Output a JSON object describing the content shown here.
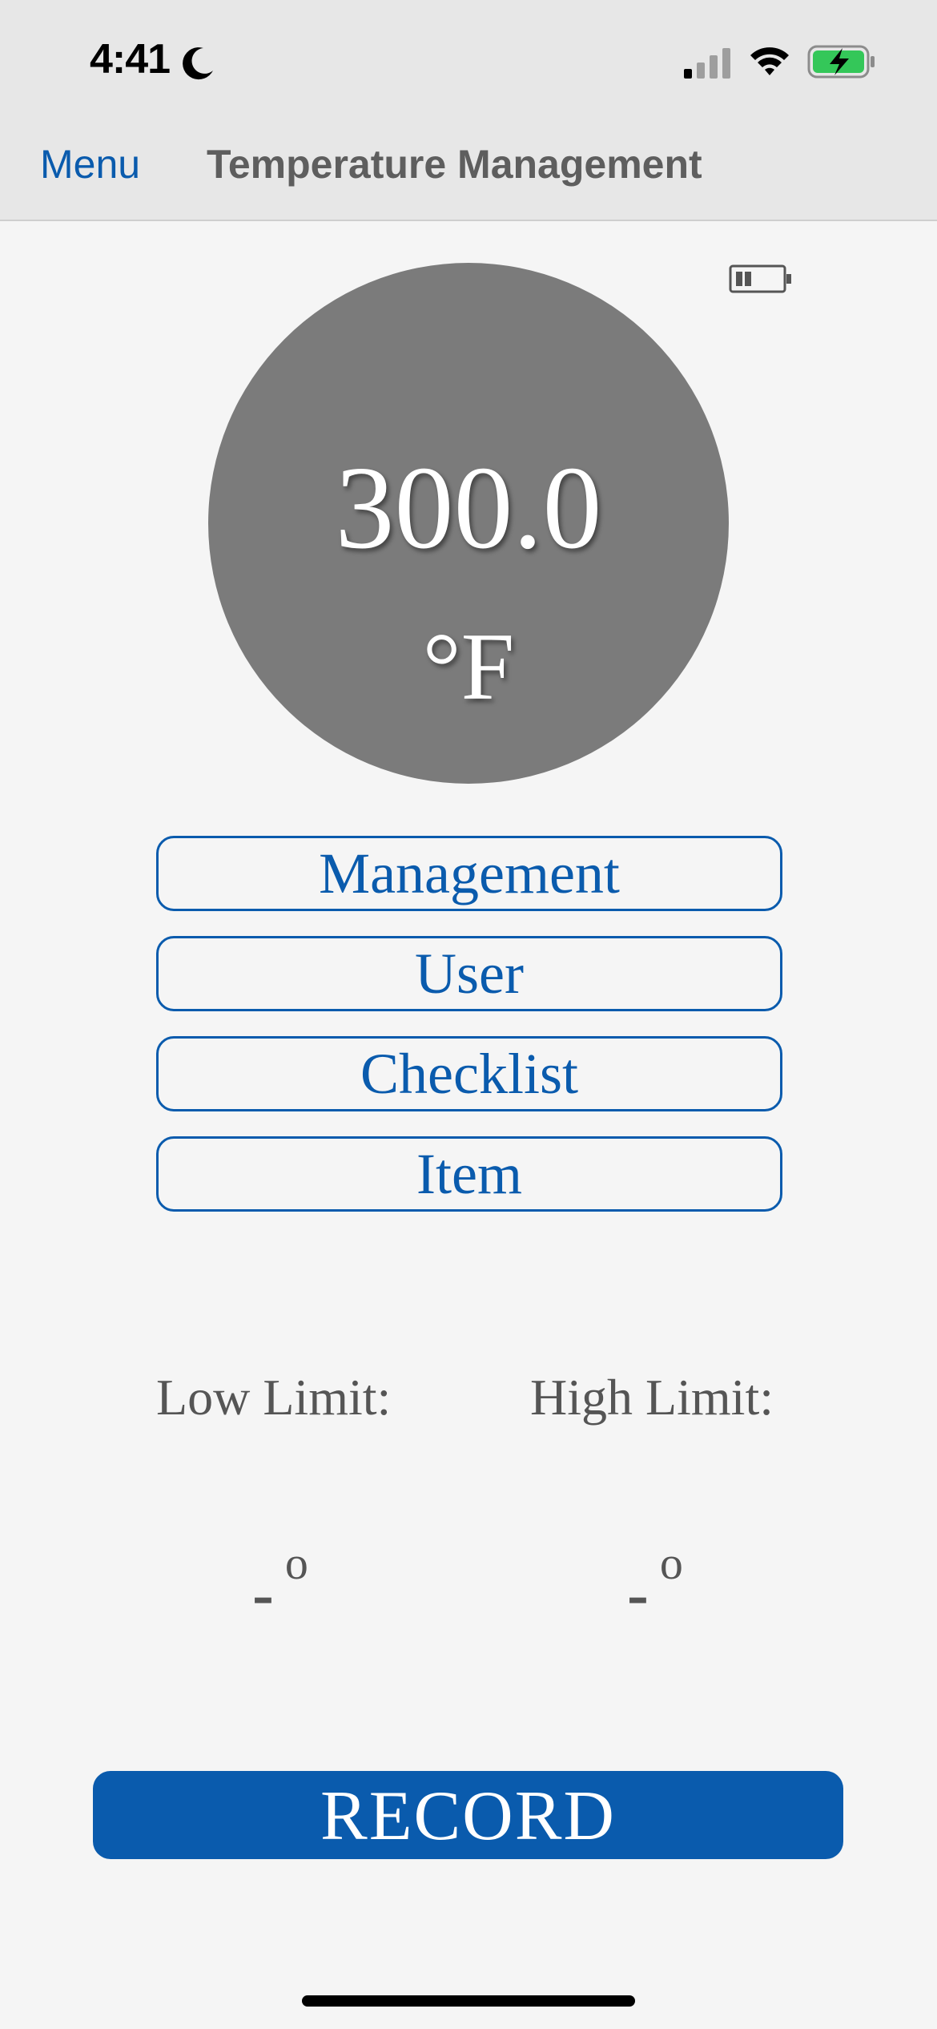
{
  "status_bar": {
    "time": "4:41",
    "icons": [
      "moon-icon",
      "cellular-signal-icon",
      "wifi-icon",
      "battery-charging-icon"
    ],
    "battery_color": "#34c759"
  },
  "nav": {
    "menu_label": "Menu",
    "title": "Temperature Management"
  },
  "device": {
    "battery_icon": "battery-low-icon"
  },
  "temperature": {
    "value": "300.0",
    "unit": "°F",
    "circle_color": "#7b7b7b"
  },
  "options": [
    {
      "label": "Management"
    },
    {
      "label": "User"
    },
    {
      "label": "Checklist"
    },
    {
      "label": "Item"
    }
  ],
  "limits": {
    "low_label": "Low Limit:",
    "high_label": "High Limit:",
    "low_value": "-",
    "high_value": "-",
    "degree_symbol": "o"
  },
  "record": {
    "label": "RECORD"
  },
  "colors": {
    "accent": "#0a5bad",
    "background": "#f5f5f5",
    "header": "#e7e7e7"
  }
}
